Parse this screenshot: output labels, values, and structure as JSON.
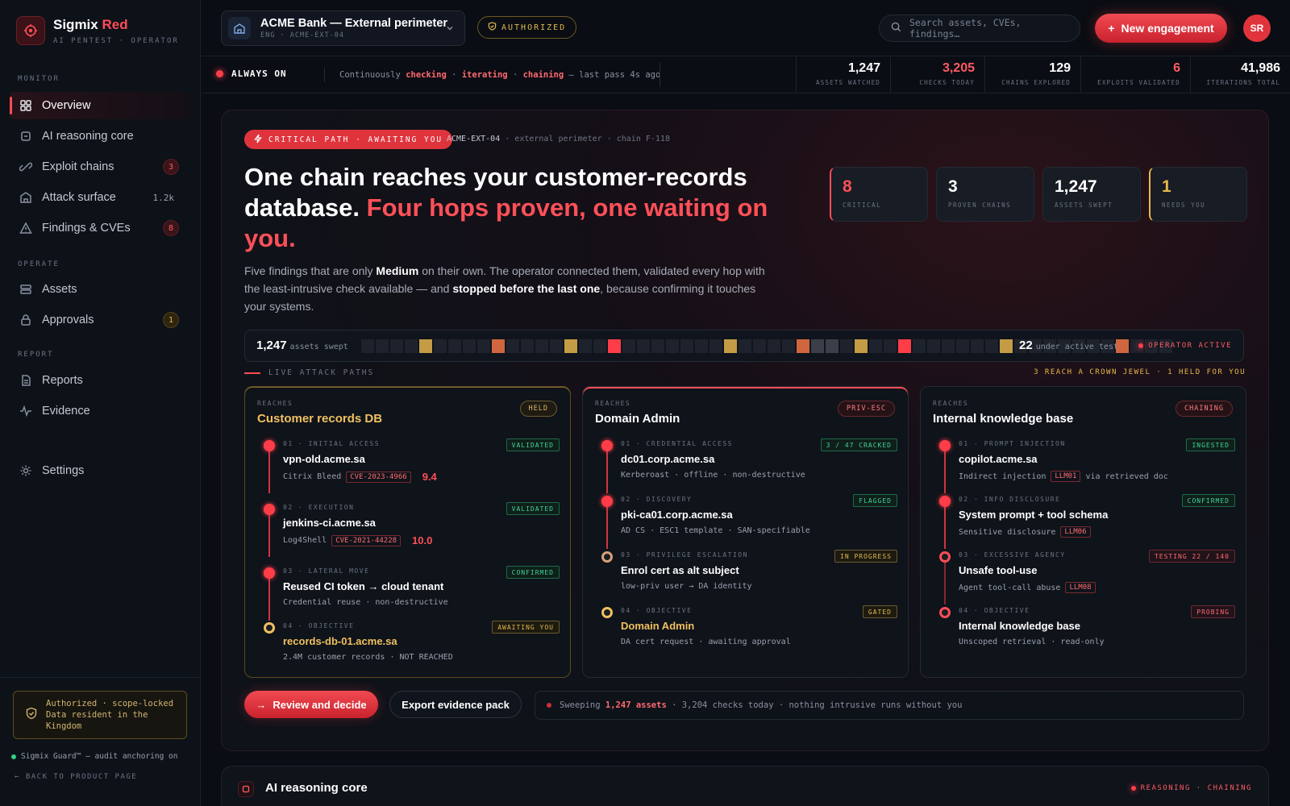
{
  "brand": {
    "name": "Sigmix",
    "name_accent": "Red",
    "subtitle": "AI PENTEST · OPERATOR"
  },
  "sidebar": {
    "sections": [
      "MONITOR",
      "OPERATE",
      "REPORT"
    ],
    "items": [
      {
        "label": "Overview",
        "icon": "grid-icon"
      },
      {
        "label": "AI reasoning core",
        "icon": "chip-icon"
      },
      {
        "label": "Exploit chains",
        "icon": "chain-icon",
        "badge": "3"
      },
      {
        "label": "Attack surface",
        "icon": "castle-icon",
        "count": "1.2k"
      },
      {
        "label": "Findings & CVEs",
        "icon": "warning-icon",
        "badge": "8"
      },
      {
        "label": "Assets",
        "icon": "server-icon"
      },
      {
        "label": "Approvals",
        "icon": "lock-icon",
        "badge": "1"
      },
      {
        "label": "Reports",
        "icon": "document-icon"
      },
      {
        "label": "Evidence",
        "icon": "pulse-icon"
      },
      {
        "label": "Settings",
        "icon": "gear-icon"
      }
    ],
    "auth_line1": "Authorized · scope-locked",
    "auth_line2": "Data resident in the",
    "auth_line3": "Kingdom",
    "guard": "Sigmix Guard™ — audit anchoring on",
    "back": "BACK TO PRODUCT PAGE"
  },
  "topbar": {
    "engagement_title": "ACME Bank — External perimeter",
    "engagement_sub": "ENG · ACME-EXT-04",
    "authorized": "AUTHORIZED",
    "search_placeholder": "Search assets, CVEs, findings…",
    "new_button": "New engagement",
    "avatar": "SR"
  },
  "status": {
    "always_on": "ALWAYS ON",
    "cont_prefix": "Continuously",
    "w1": "checking",
    "w2": "iterating",
    "w3": "chaining",
    "cont_suffix": "— last pass 4s ago",
    "stats": [
      {
        "value": "1,247",
        "label": "ASSETS WATCHED"
      },
      {
        "value": "3,205",
        "label": "CHECKS TODAY",
        "accent": "red"
      },
      {
        "value": "129",
        "label": "CHAINS EXPLORED"
      },
      {
        "value": "6",
        "label": "EXPLOITS VALIDATED",
        "accent": "red"
      },
      {
        "value": "41,986",
        "label": "ITERATIONS TOTAL"
      }
    ]
  },
  "hero": {
    "pill": "CRITICAL PATH · AWAITING YOU",
    "meta_id": "ACME-EXT-04",
    "meta_rest": "· external perimeter · chain F-118",
    "headline_a": "One chain reaches your customer-records database.",
    "headline_b": "Four hops proven, one waiting on you.",
    "lede_1": "Five findings that are only ",
    "lede_bold1": "Medium",
    "lede_2": " on their own. The operator connected them, validated every hop with the least-intrusive check available — and ",
    "lede_bold2": "stopped before the last one",
    "lede_3": ", because confirming it touches your systems.",
    "kpis": [
      {
        "value": "8",
        "label": "CRITICAL"
      },
      {
        "value": "3",
        "label": "PROVEN CHAINS"
      },
      {
        "value": "1,247",
        "label": "ASSETS SWEPT"
      },
      {
        "value": "1",
        "label": "NEEDS YOU"
      }
    ]
  },
  "sweep": {
    "left_value": "1,247",
    "left_label": "assets swept",
    "right_value": "22",
    "right_label": "under active test",
    "operator": "OPERATOR ACTIVE",
    "cells": [
      "n",
      "n",
      "n",
      "n",
      "a",
      "n",
      "n",
      "n",
      "n",
      "o",
      "n",
      "n",
      "n",
      "n",
      "a",
      "n",
      "n",
      "r",
      "n",
      "n",
      "n",
      "n",
      "n",
      "n",
      "n",
      "a",
      "n",
      "n",
      "n",
      "n",
      "o",
      "g",
      "g",
      "n",
      "a",
      "n",
      "n",
      "r",
      "n",
      "n",
      "n",
      "n",
      "n",
      "n",
      "a",
      "n",
      "n",
      "n",
      "n",
      "n",
      "n",
      "n",
      "o",
      "n",
      "n",
      "n"
    ]
  },
  "paths": {
    "label": "LIVE ATTACK PATHS",
    "right": "3 REACH A CROWN JEWEL · 1 HELD FOR YOU",
    "reaches": "REACHES",
    "cards": [
      {
        "title": "Customer records DB",
        "badge": "HELD",
        "steps": [
          {
            "label": "01 · INITIAL ACCESS",
            "host": "vpn-old.acme.sa",
            "desc": "Citrix Bleed",
            "cve": "CVE-2023-4966",
            "score": "9.4",
            "tag": "VALIDATED"
          },
          {
            "label": "02 · EXECUTION",
            "host": "jenkins-ci.acme.sa",
            "desc": "Log4Shell",
            "cve": "CVE-2021-44228",
            "score": "10.0",
            "tag": "VALIDATED"
          },
          {
            "label": "03 · LATERAL MOVE",
            "host": "Reused CI token → cloud tenant",
            "desc": "Credential reuse · non-destructive",
            "tag": "CONFIRMED"
          },
          {
            "label": "04 · OBJECTIVE",
            "host": "records-db-01.acme.sa",
            "desc": "2.4M customer records · NOT REACHED",
            "tag": "AWAITING YOU"
          }
        ]
      },
      {
        "title": "Domain Admin",
        "badge": "PRIV-ESC",
        "steps": [
          {
            "label": "01 · CREDENTIAL ACCESS",
            "host": "dc01.corp.acme.sa",
            "desc": "Kerberoast · offline · non-destructive",
            "tag": "3 / 47 CRACKED"
          },
          {
            "label": "02 · DISCOVERY",
            "host": "pki-ca01.corp.acme.sa",
            "desc": "AD CS · ESC1 template · SAN-specifiable",
            "tag": "FLAGGED"
          },
          {
            "label": "03 · PRIVILEGE ESCALATION",
            "host": "Enrol cert as alt subject",
            "desc": "low-priv user → DA identity",
            "tag": "IN PROGRESS"
          },
          {
            "label": "04 · OBJECTIVE",
            "host": "Domain Admin",
            "desc": "DA cert request · awaiting approval",
            "tag": "GATED"
          }
        ]
      },
      {
        "title": "Internal knowledge base",
        "badge": "CHAINING",
        "steps": [
          {
            "label": "01 · PROMPT INJECTION",
            "host": "copilot.acme.sa",
            "desc": "Indirect injection",
            "llm": "LLM01",
            "desc2": "via retrieved doc",
            "tag": "INGESTED"
          },
          {
            "label": "02 · INFO DISCLOSURE",
            "host": "System prompt + tool schema",
            "desc": "Sensitive disclosure",
            "llm": "LLM06",
            "tag": "CONFIRMED"
          },
          {
            "label": "03 · EXCESSIVE AGENCY",
            "host": "Unsafe tool-use",
            "desc": "Agent tool-call abuse",
            "llm": "LLM08",
            "tag": "TESTING 22 / 140"
          },
          {
            "label": "04 · OBJECTIVE",
            "host": "Internal knowledge base",
            "desc": "Unscoped retrieval · read-only",
            "tag": "PROBING"
          }
        ]
      }
    ]
  },
  "actions": {
    "review": "Review and decide",
    "export": "Export evidence pack",
    "note_a": "Sweeping",
    "note_b": "1,247 assets",
    "note_c": "· 3,204 checks today · nothing intrusive runs without you"
  },
  "ai": {
    "title": "AI reasoning core",
    "right": "REASONING · CHAINING"
  },
  "colors": {
    "accent": "#ff4d57",
    "amber": "#e8b84a",
    "green": "#3fd39a",
    "bg": "#0a0d13"
  }
}
